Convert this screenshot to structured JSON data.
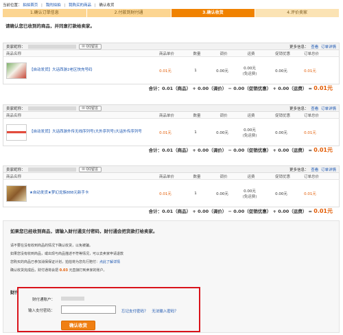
{
  "breadcrumb": {
    "prefix": "当前位置：",
    "items": [
      "拍拍首页",
      "我的拍拍",
      "我购买的商品",
      "确认收货"
    ]
  },
  "steps": [
    "1.确认订单信息",
    "2.付款到财付通",
    "3.确认收货",
    "4.评价卖家"
  ],
  "intro": "请确认您已收到的商品，并同意打款给卖家。",
  "shop_common": {
    "seller_label": "卖家昵称：",
    "contact_label": "QQ留言",
    "more_info": "更多信息：",
    "view_label": "查看",
    "detail_link": "订单详情"
  },
  "columns": [
    "商品名称",
    "商品单价",
    "数量",
    "调价",
    "运费",
    "促销优惠",
    "订单总价"
  ],
  "colors": {
    "accent": "#f08200",
    "price": "#e25a00",
    "link": "#1a55b0",
    "highlight_border": "#d9121a"
  },
  "orders": [
    {
      "product": "【自动发货】大话西游2老区快充号码",
      "unit_price": "0.01元",
      "qty": "1",
      "adjust": "0.00元",
      "shipping": "0.00元",
      "shipping_note": "(免运费)",
      "discount": "0.00元",
      "order_total": "0.01元",
      "total_line": {
        "label": "合计：",
        "product": "0.01",
        "product_unit": "（商品）",
        "adjust": "0.00",
        "adjust_unit": "（调价）",
        "discount": "0.00",
        "discount_unit": "（促销优惠）",
        "shipping": "0.00",
        "shipping_unit": "（运费）",
        "equals": "=",
        "sum": "0.01",
        "sum_unit": "元"
      }
    },
    {
      "product": "【自动发货】大话西游外传无线序列号(大外序列号)大话外传序列号",
      "unit_price": "0.01元",
      "qty": "1",
      "adjust": "0.00元",
      "shipping": "0.00元",
      "shipping_note": "(免运费)",
      "discount": "0.00元",
      "order_total": "0.01元",
      "total_line": {
        "label": "合计：",
        "product": "0.01",
        "product_unit": "（商品）",
        "adjust": "0.00",
        "adjust_unit": "（调价）",
        "discount": "0.00",
        "discount_unit": "（促销优惠）",
        "shipping": "0.00",
        "shipping_unit": "（运费）",
        "equals": "=",
        "sum": "0.01",
        "sum_unit": "元"
      }
    },
    {
      "product": "★自动发货★梦幻龙族888元新手卡",
      "unit_price": "0.01元",
      "qty": "1",
      "adjust": "0.00元",
      "shipping": "0.00元",
      "shipping_note": "(免运费)",
      "discount": "0.00元",
      "order_total": "0.01元",
      "total_line": {
        "label": "合计：",
        "product": "0.01",
        "product_unit": "（商品）",
        "adjust": "0.00",
        "adjust_unit": "（调价）",
        "discount": "0.00",
        "discount_unit": "（促销优惠）",
        "shipping": "0.00",
        "shipping_unit": "（运费）",
        "equals": "=",
        "sum": "0.01",
        "sum_unit": "元"
      }
    }
  ],
  "lower": {
    "heading": "如果您已经收到商品，请输入财付通支付密码，财付通会把货款打给卖家。",
    "warning": "请不要在没有收到商品的情况下确认收货，以免被骗。",
    "notice1": "如果您没有收到商品，或出现与商品描述不符等情况，可以去卖家申请退款",
    "notice2": "您购买的商品已参加消保保证计划，拍拍将为您先行赔付：",
    "notice2_link": "点此了解详情",
    "notice3_pre": "确认收货完成后，财付通将会把",
    "notice3_amount": "0.03",
    "notice3_post": "元直接打到卖家的账户。",
    "security_title": "财付通安全验证",
    "account_label": "财付通账户：",
    "password_label": "输入支付密码：",
    "forgot_link": "忘记支付密码？",
    "no_pwd_link": "无法输入密码？",
    "confirm_button": "确认收货"
  }
}
